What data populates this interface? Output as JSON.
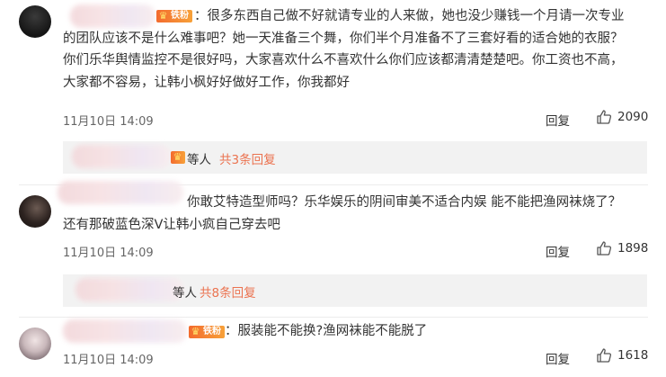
{
  "comments": [
    {
      "badge": "铁粉",
      "text_lines": [
        "：很多东西自己做不好就请专业的人来做，她也没少赚钱一个月请一次专业",
        "的团队应该不是什么难事吧？她一天准备三个舞，你们半个月准备不了三套好看的适合她的衣服？",
        "你们乐华舆情监控不是很好吗，大家喜欢什么不喜欢什么你们应该都清清楚楚吧。你工资也不高，",
        "大家都不容易，让韩小枫好好做好工作，你我都好"
      ],
      "time": "11月10日 14:09",
      "reply_label": "回复",
      "likes": "2090",
      "sub_replies": {
        "who": "等人",
        "more": "共3条回复"
      }
    },
    {
      "badge": "",
      "text_lines": [
        "你敢艾特造型师吗？乐华娱乐的阴间审美不适合内娱 能不能把渔网袜烧了？",
        "还有那破蓝色深V让韩小疯自己穿去吧"
      ],
      "time": "11月10日 14:09",
      "reply_label": "回复",
      "likes": "1898",
      "sub_replies": {
        "who": "等人",
        "more": "共8条回复"
      }
    },
    {
      "badge": "铁粉",
      "text_lines": [
        "：服装能不能换?渔网袜能不能脱了"
      ],
      "time": "11月10日 14:09",
      "reply_label": "回复",
      "likes": "1618"
    }
  ],
  "icons": {
    "like": "thumbs-up-icon",
    "fan_badge": "crown-icon",
    "avatar": "avatar"
  },
  "colors": {
    "link": "#eb7350",
    "fan_badge": "#f36b2e",
    "text": "#333333",
    "meta": "#666666"
  }
}
